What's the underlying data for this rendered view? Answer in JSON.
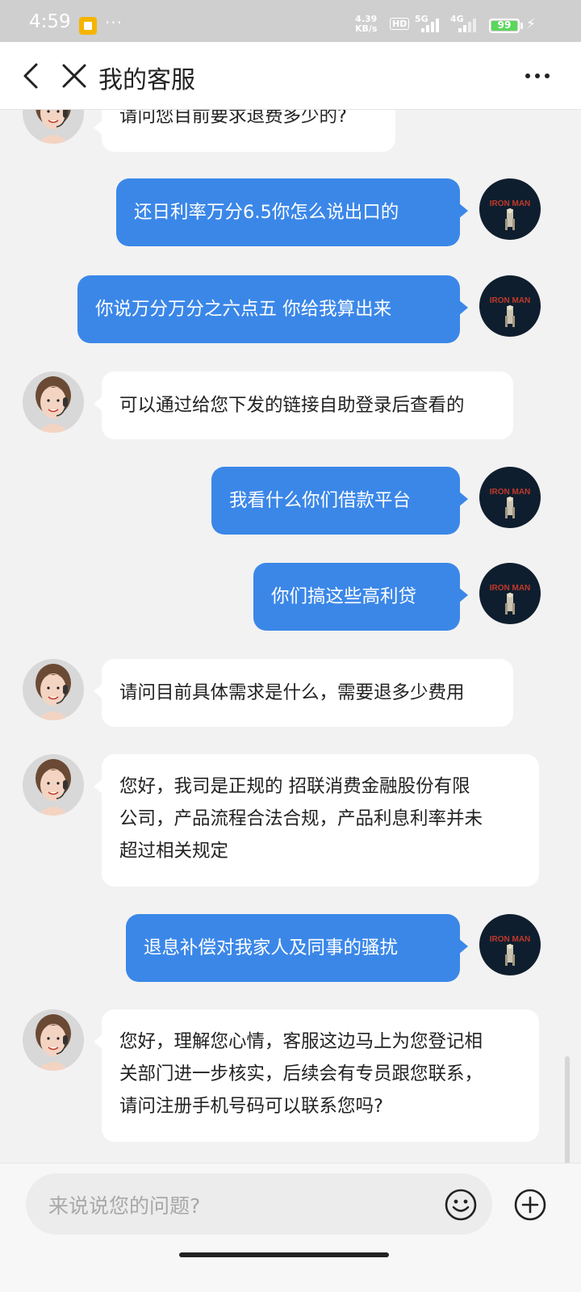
{
  "status_bar": {
    "time": "4:59",
    "dots": "···",
    "net_speed_value": "4.39",
    "net_speed_unit": "KB/s",
    "hd_label": "HD",
    "net_5g": "5G",
    "net_4g": "4G",
    "battery_level": "99",
    "battery_fraction": 0.99
  },
  "header": {
    "title": "我的客服"
  },
  "messages": [
    {
      "sender": "agent",
      "text": "请问您目前要求退费多少的?"
    },
    {
      "sender": "user",
      "text": "还日利率万分6.5你怎么说出口的"
    },
    {
      "sender": "user",
      "text": "你说万分万分之六点五 你给我算出来"
    },
    {
      "sender": "agent",
      "text": "可以通过给您下发的链接自助登录后查看的"
    },
    {
      "sender": "user",
      "text": "我看什么你们借款平台"
    },
    {
      "sender": "user",
      "text": "你们搞这些高利贷"
    },
    {
      "sender": "agent",
      "text": "请问目前具体需求是什么，需要退多少费用"
    },
    {
      "sender": "agent",
      "lines": [
        "您好，我司是正规的 招联消费金融股份有限",
        "公司，产品流程合法合规，产品利息利率并未",
        "超过相关规定"
      ]
    },
    {
      "sender": "user",
      "text": "退息补偿对我家人及同事的骚扰"
    },
    {
      "sender": "agent",
      "lines": [
        "您好，理解您心情，客服这边马上为您登记相",
        "关部门进一步核实，后续会有专员跟您联系，",
        "请问注册手机号码可以联系您吗?"
      ]
    }
  ],
  "input": {
    "placeholder": "来说说您的问题?"
  },
  "avatar_text": {
    "user": "IRON MAN"
  },
  "colors": {
    "user_bubble": "#3b87e8",
    "agent_bubble": "#ffffff",
    "background": "#f2f2f2",
    "battery_fill": "#5cd65c"
  }
}
